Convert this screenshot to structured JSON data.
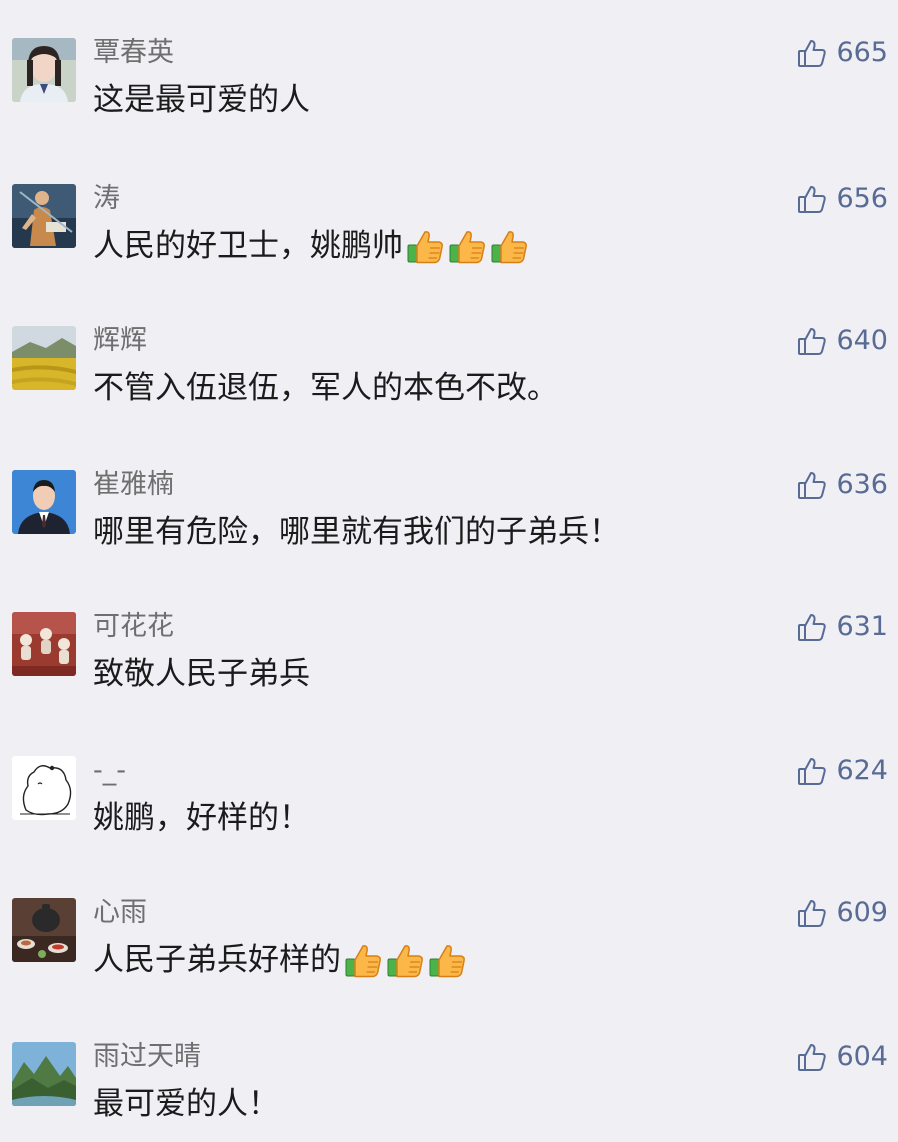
{
  "colors": {
    "background": "#f0eff4",
    "username": "#6f6f6f",
    "text": "#1b1b1b",
    "like": "#576b95"
  },
  "icons": {
    "like": "thumbs-up-outline-icon",
    "emoji": "thumbs-up-emoji-icon"
  },
  "comments": [
    {
      "username": "覃春英",
      "text": "这是最可爱的人",
      "likes": "665",
      "thumbs": 0
    },
    {
      "username": "涛",
      "text": "人民的好卫士，姚鹏帅",
      "likes": "656",
      "thumbs": 3
    },
    {
      "username": "辉辉",
      "text": "不管入伍退伍，军人的本色不改。",
      "likes": "640",
      "thumbs": 0
    },
    {
      "username": "崔雅楠",
      "text": "哪里有危险，哪里就有我们的子弟兵！",
      "likes": "636",
      "thumbs": 0
    },
    {
      "username": "可花花",
      "text": "致敬人民子弟兵",
      "likes": "631",
      "thumbs": 0
    },
    {
      "username": "-_-",
      "text": "姚鹏，好样的！",
      "likes": "624",
      "thumbs": 0
    },
    {
      "username": "心雨",
      "text": "人民子弟兵好样的",
      "likes": "609",
      "thumbs": 3
    },
    {
      "username": "雨过天晴",
      "text": "最可爱的人！",
      "likes": "604",
      "thumbs": 0
    }
  ]
}
